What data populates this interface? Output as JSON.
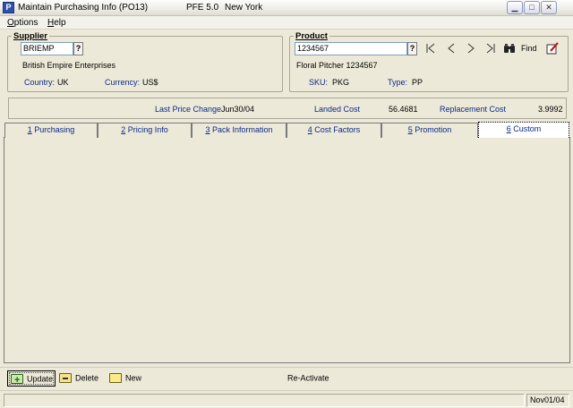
{
  "window": {
    "app_icon": "P",
    "title": "Maintain Purchasing Info (PO13)",
    "version": "PFE 5.0",
    "location": "New York",
    "controls": {
      "minimize": "minimize-icon",
      "maximize": "maximize-icon",
      "close": "close-icon"
    }
  },
  "menu": {
    "options": "Options",
    "help": "Help"
  },
  "supplier": {
    "title": "Supplier",
    "code": "BRIEMP",
    "lookup_label": "?",
    "name": "British Empire Enterprises",
    "country_label": "Country:",
    "country_value": "UK",
    "currency_label": "Currency:",
    "currency_value": "US$"
  },
  "product": {
    "title": "Product",
    "code": "1234567",
    "lookup_label": "?",
    "description": "Floral Pitcher 1234567",
    "sku_label": "SKU:",
    "sku_value": "PKG",
    "type_label": "Type:",
    "type_value": "PP",
    "find_label": "Find",
    "nav_icons": [
      "first-record-icon",
      "previous-record-icon",
      "next-record-icon",
      "last-record-icon",
      "binoculars-icon",
      "edit-note-icon"
    ]
  },
  "info": {
    "last_price_change_label": "Last Price Change",
    "last_price_change_value": "Jun30/04",
    "landed_cost_label": "Landed Cost",
    "landed_cost_value": "56.4681",
    "replacement_cost_label": "Replacement Cost",
    "replacement_cost_value": "3.9992"
  },
  "tabs": [
    {
      "key": "1",
      "label": " Purchasing"
    },
    {
      "key": "2",
      "label": " Pricing Info"
    },
    {
      "key": "3",
      "label": " Pack Information"
    },
    {
      "key": "4",
      "label": " Cost Factors"
    },
    {
      "key": "5",
      "label": " Promotion"
    },
    {
      "key": "6",
      "label": " Custom"
    }
  ],
  "active_tab": "6",
  "actions": {
    "update": "Update",
    "delete": "Delete",
    "new": "New",
    "reactivate": "Re-Activate"
  },
  "status": {
    "message": "",
    "date": "Nov01/04"
  },
  "colors": {
    "background": "#ece9d8",
    "label_blue": "#0b2b86",
    "field_border": "#7f9db9"
  }
}
